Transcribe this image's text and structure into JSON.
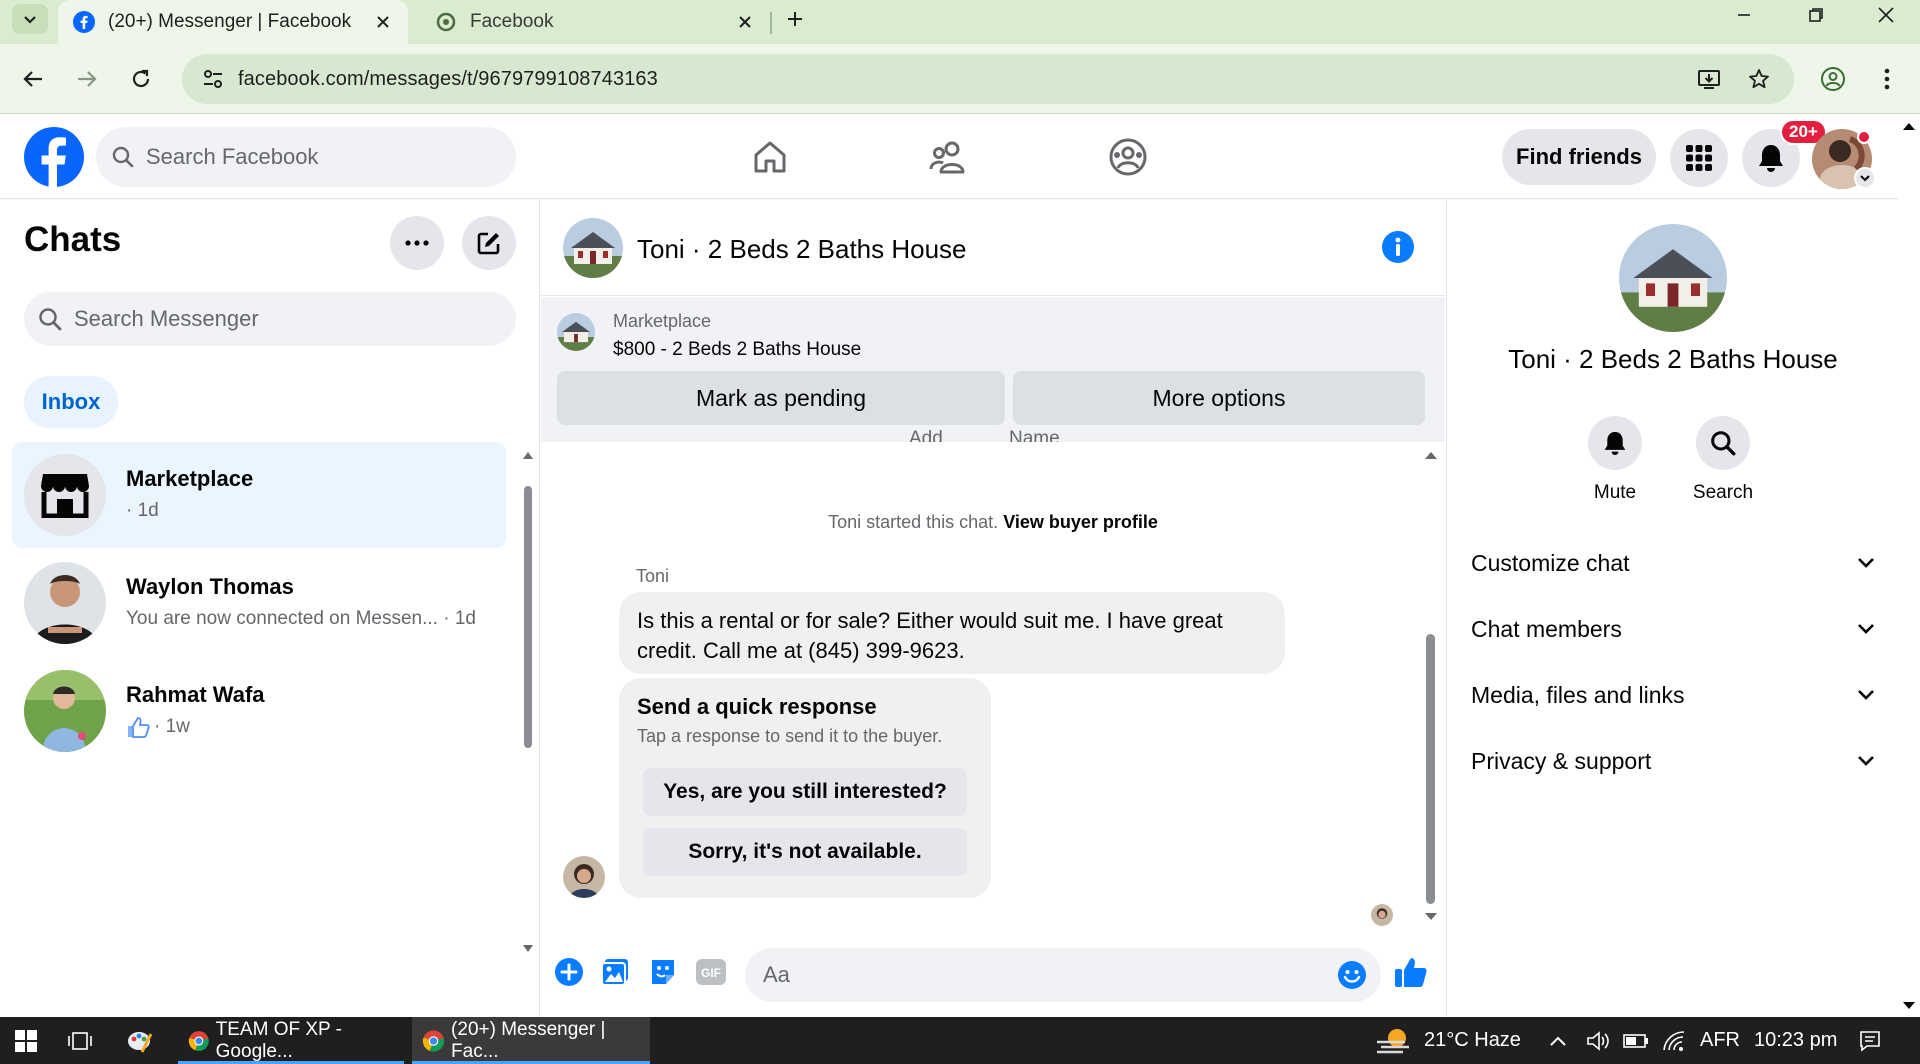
{
  "browser": {
    "tabs": [
      {
        "title": "(20+) Messenger | Facebook",
        "active": true
      },
      {
        "title": "Facebook",
        "active": false
      }
    ],
    "url": "facebook.com/messages/t/9679799108743163"
  },
  "header": {
    "search_placeholder": "Search Facebook",
    "find_friends_label": "Find friends",
    "notification_badge": "20+"
  },
  "chats": {
    "title": "Chats",
    "search_placeholder": "Search Messenger",
    "inbox_label": "Inbox",
    "items": [
      {
        "name": "Marketplace",
        "subtitle": "· 1d"
      },
      {
        "name": "Waylon Thomas",
        "subtitle": "You are now connected on Messen... · 1d"
      },
      {
        "name": "Rahmat Wafa",
        "subtitle": "· 1w"
      }
    ]
  },
  "conversation": {
    "title": "Toni · 2 Beds 2 Baths House",
    "marketplace_label": "Marketplace",
    "listing": "$800 - 2 Beds 2 Baths House",
    "mark_pending_label": "Mark as pending",
    "more_options_label": "More options",
    "cut_text_1": "Add",
    "cut_text_2": "Name",
    "started_text": "Toni started this chat.",
    "view_profile_label": "View buyer profile",
    "sender": "Toni",
    "message": "Is this a rental or for sale? Either would suit me. I have great credit. Call me at (845) 399-9623.",
    "quick_response_title": "Send a quick response",
    "quick_response_subtitle": "Tap a response to send it to the buyer.",
    "quick_replies": [
      "Yes, are you still interested?",
      "Sorry, it's not available."
    ],
    "composer_placeholder": "Aa"
  },
  "info_panel": {
    "name": "Toni · 2 Beds 2 Baths House",
    "mute_label": "Mute",
    "search_label": "Search",
    "sections": [
      "Customize chat",
      "Chat members",
      "Media, files and links",
      "Privacy & support"
    ]
  },
  "taskbar": {
    "apps": [
      "TEAM OF XP - Google...",
      "(20+) Messenger | Fac..."
    ],
    "weather": "21°C  Haze",
    "language": "AFR",
    "time": "10:23 pm"
  },
  "colors": {
    "facebook_blue": "#0866ff",
    "messenger_accent": "#0a7cff",
    "selected_chat_bg": "#ebf5ff",
    "badge_red": "#e41e3f",
    "browser_chrome": "#d9ecd0"
  },
  "icons": [
    "dropdown-icon",
    "facebook-favicon",
    "close-icon",
    "plus-icon",
    "back-icon",
    "forward-icon",
    "reload-icon",
    "site-settings-icon",
    "install-icon",
    "star-icon",
    "account-icon",
    "kebab-icon",
    "facebook-logo",
    "search-icon",
    "home-icon",
    "friends-icon",
    "groups-icon",
    "apps-grid-icon",
    "bell-icon",
    "more-icon",
    "compose-icon",
    "store-icon",
    "like-icon",
    "info-icon",
    "add-icon",
    "image-icon",
    "sticker-icon",
    "gif-icon",
    "emoji-icon",
    "windows-icon",
    "task-view-icon",
    "weather-icon",
    "chevron-down-icon",
    "wifi-icon",
    "volume-icon",
    "battery-icon"
  ]
}
